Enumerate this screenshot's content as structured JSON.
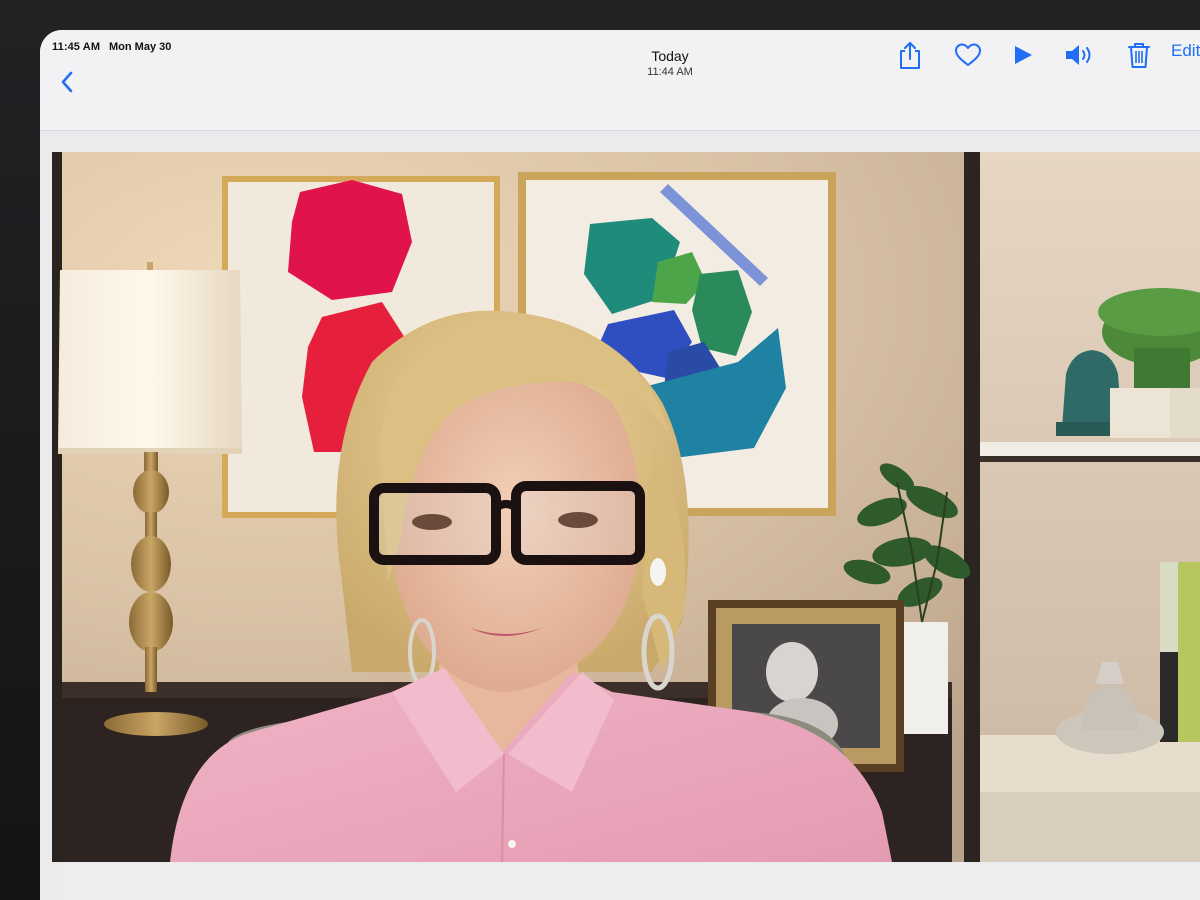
{
  "status_bar": {
    "time": "11:45 AM",
    "date": "Mon May 30"
  },
  "header": {
    "title": "Today",
    "subtitle": "11:44 AM"
  },
  "toolbar": {
    "back_icon": "chevron-left-icon",
    "share_icon": "share-icon",
    "favorite_icon": "heart-icon",
    "play_icon": "play-icon",
    "sound_icon": "speaker-icon",
    "delete_icon": "trash-icon",
    "edit_label": "Edit"
  },
  "colors": {
    "accent": "#1f6ef5",
    "background": "#ebebed"
  }
}
